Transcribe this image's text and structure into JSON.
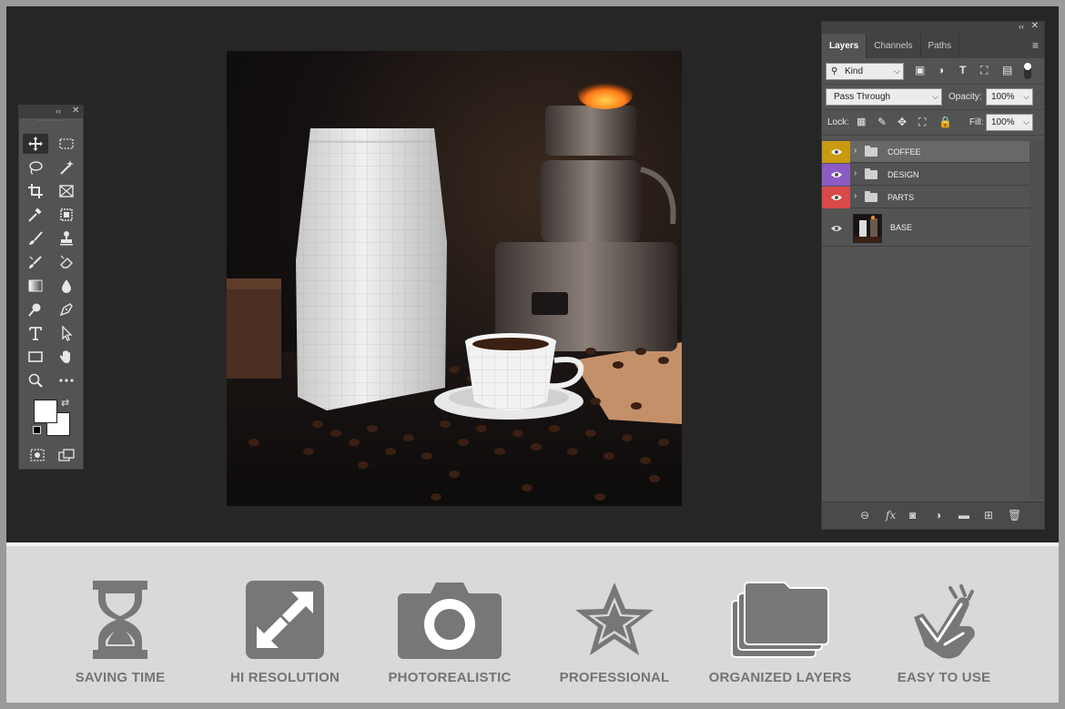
{
  "toolbox": {
    "tools": [
      "move-tool",
      "marquee-tool",
      "lasso-tool",
      "magic-wand-tool",
      "crop-tool",
      "frame-tool",
      "eyedropper-tool",
      "healing-tool",
      "brush-tool",
      "stamp-tool",
      "history-brush-tool",
      "eraser-tool",
      "gradient-tool",
      "blur-tool",
      "dodge-tool",
      "pen-tool",
      "type-tool",
      "path-selection-tool",
      "rectangle-tool",
      "hand-tool",
      "zoom-tool",
      "more-tools"
    ]
  },
  "layers_panel": {
    "tabs": [
      "Layers",
      "Channels",
      "Paths"
    ],
    "filter": {
      "value": "Kind"
    },
    "blend_mode": "Pass Through",
    "opacity_label": "Opacity:",
    "opacity_value": "100%",
    "lock_label": "Lock:",
    "fill_label": "Fill:",
    "fill_value": "100%",
    "layers": [
      {
        "name": "COFFEE",
        "color": "#c89a12",
        "type": "group"
      },
      {
        "name": "DESIGN",
        "color": "#8c5bc3",
        "type": "group"
      },
      {
        "name": "PARTS",
        "color": "#d84a4a",
        "type": "group"
      },
      {
        "name": "BASE",
        "type": "image"
      }
    ]
  },
  "features": [
    {
      "label": "SAVING TIME",
      "icon": "hourglass-icon"
    },
    {
      "label": "HI RESOLUTION",
      "icon": "expand-icon"
    },
    {
      "label": "PHOTOREALISTIC",
      "icon": "camera-icon"
    },
    {
      "label": "PROFESSIONAL",
      "icon": "star-icon"
    },
    {
      "label": "ORGANIZED LAYERS",
      "icon": "folders-icon"
    },
    {
      "label": "EASY TO USE",
      "icon": "pointing-hand-icon"
    }
  ],
  "colors": {
    "workspace": "#262626",
    "panel": "#535353",
    "feature_icon": "#777777"
  }
}
